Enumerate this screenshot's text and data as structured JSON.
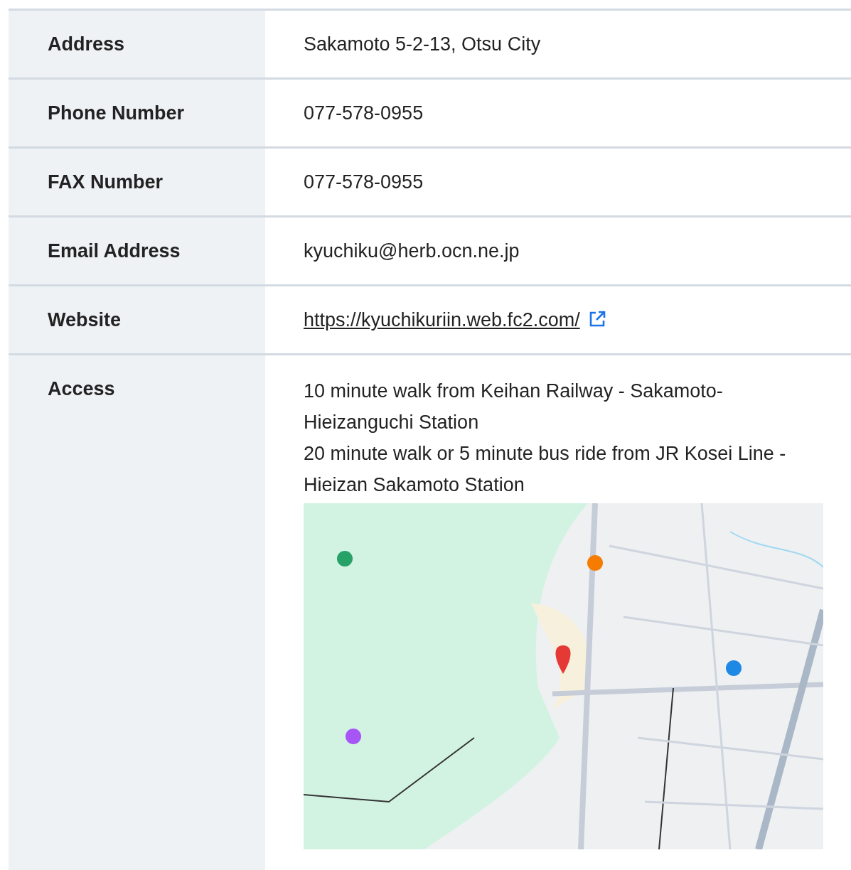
{
  "rows": [
    {
      "label": "Address",
      "kind": "text",
      "value": "Sakamoto 5-2-13, Otsu City"
    },
    {
      "label": "Phone Number",
      "kind": "text",
      "value": "077-578-0955"
    },
    {
      "label": "FAX Number",
      "kind": "text",
      "value": "077-578-0955"
    },
    {
      "label": "Email Address",
      "kind": "text",
      "value": "kyuchiku@herb.ocn.ne.jp"
    },
    {
      "label": "Website",
      "kind": "link",
      "value": "https://kyuchikuriin.web.fc2.com/"
    },
    {
      "label": "Access",
      "kind": "access",
      "lines": [
        "10 minute walk from Keihan Railway - Sakamoto-Hieizanguchi Station",
        "20 minute walk or 5 minute bus ride from JR Kosei Line - Hieizan Sakamoto Station"
      ]
    }
  ]
}
